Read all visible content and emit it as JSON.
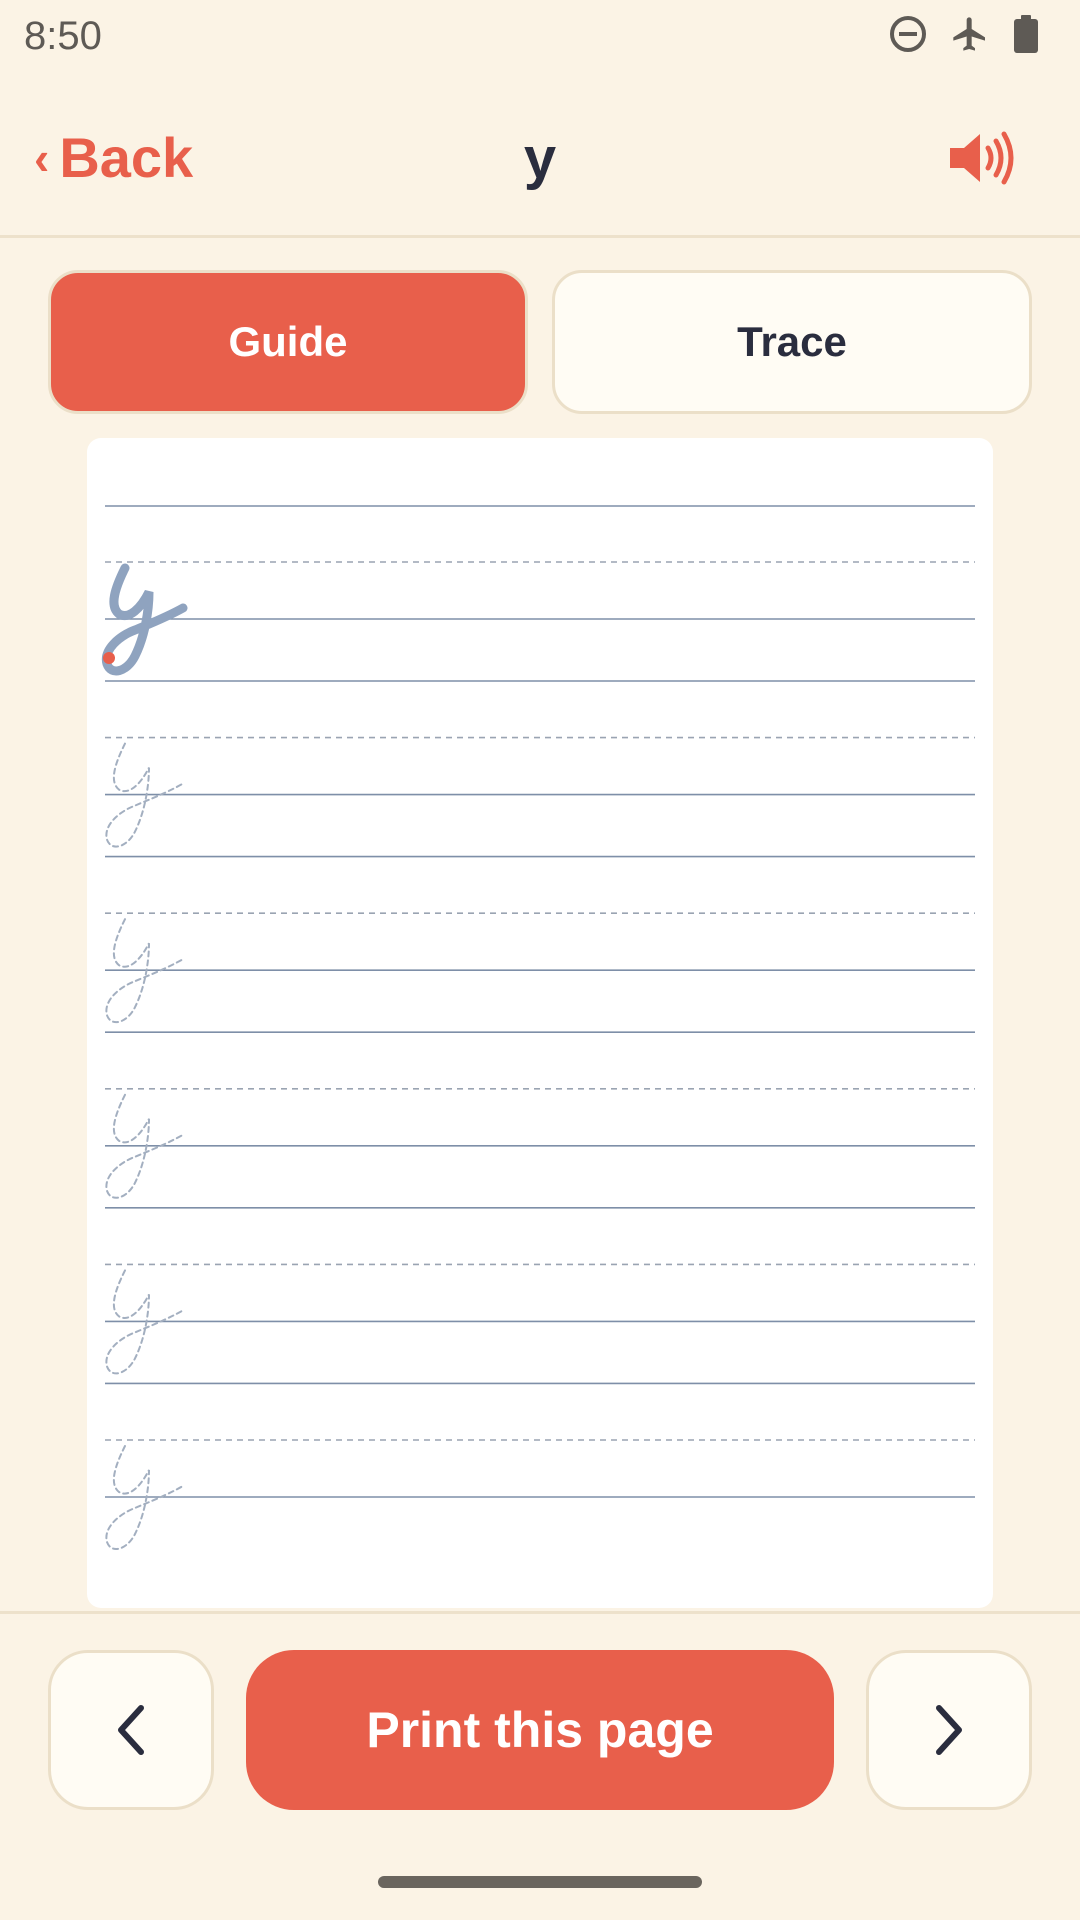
{
  "status_bar": {
    "time": "8:50",
    "icons": [
      "do-not-disturb-icon",
      "airplane-mode-icon",
      "battery-icon"
    ]
  },
  "header": {
    "back_label": "Back",
    "back_chevron": "‹",
    "title": "y",
    "sound_icon": "speaker-icon"
  },
  "tabs": [
    {
      "label": "Guide",
      "active": true
    },
    {
      "label": "Trace",
      "active": false
    }
  ],
  "worksheet": {
    "letter": "y",
    "guide_rows": 1,
    "trace_rows": 5,
    "start_dot_color": "#E85F4B",
    "line_color": "#8FA3BF"
  },
  "footer": {
    "print_label": "Print this page",
    "prev_icon": "chevron-left-icon",
    "next_icon": "chevron-right-icon"
  },
  "colors": {
    "accent": "#E85F4B",
    "background": "#FBF3E5",
    "text": "#2A2D3E"
  }
}
